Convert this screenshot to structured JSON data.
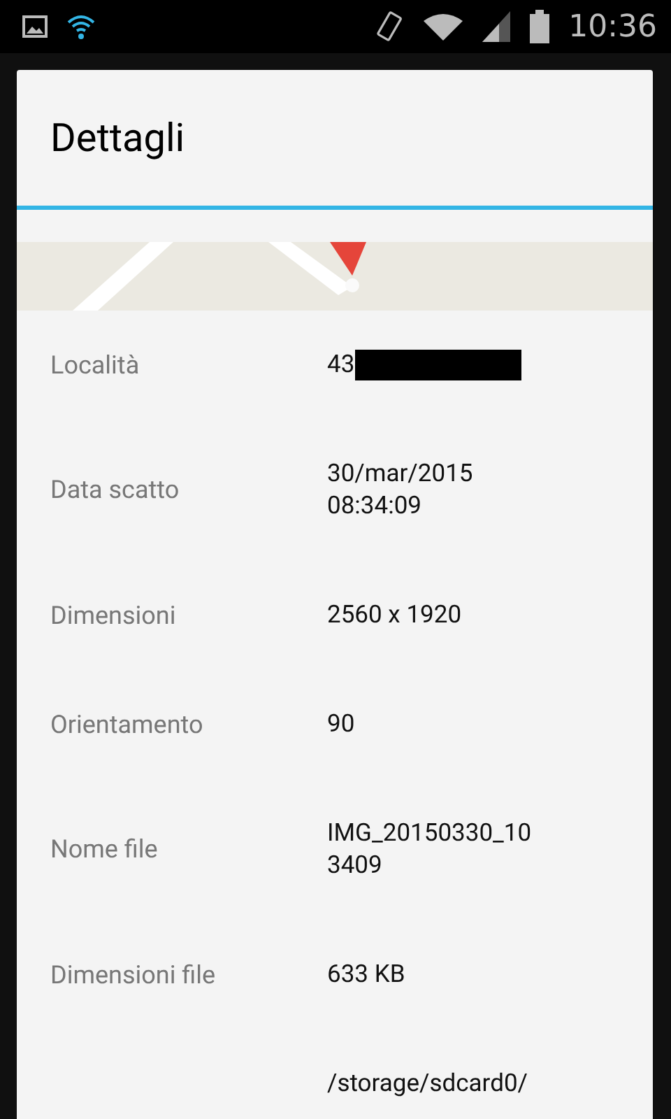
{
  "status_bar": {
    "time": "10:36"
  },
  "dialog": {
    "title": "Dettagli",
    "rows": [
      {
        "label": "Località",
        "value": "43",
        "redacted": true
      },
      {
        "label": "Data scatto",
        "value": "30/mar/2015\n08:34:09",
        "redacted": false
      },
      {
        "label": "Dimensioni",
        "value": "2560 x 1920",
        "redacted": false
      },
      {
        "label": "Orientamento",
        "value": "90",
        "redacted": false
      },
      {
        "label": "Nome file",
        "value": "IMG_20150330_10\n3409",
        "redacted": false
      },
      {
        "label": "Dimensioni file",
        "value": "633 KB",
        "redacted": false
      },
      {
        "value": "/storage/sdcard0/",
        "redacted": false
      }
    ]
  }
}
